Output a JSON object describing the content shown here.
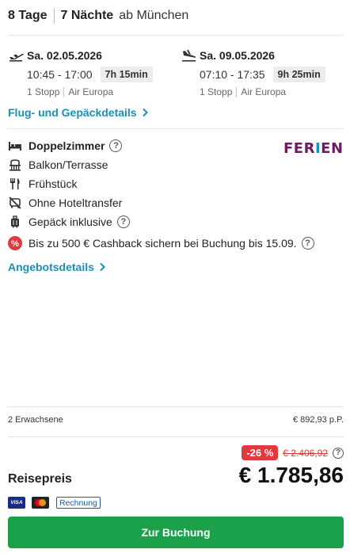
{
  "header": {
    "days": "8 Tage",
    "nights": "7 Nächte",
    "departure": "ab München"
  },
  "outbound": {
    "date": "Sa. 02.05.2026",
    "times": "10:45 - 17:00",
    "duration": "7h 15min",
    "stops": "1 Stopp",
    "airline": "Air Europa",
    "icon": "plane-takeoff-icon"
  },
  "inbound": {
    "date": "Sa. 09.05.2026",
    "times": "07:10 - 17:35",
    "duration": "9h 25min",
    "stops": "1 Stopp",
    "airline": "Air Europa",
    "icon": "plane-landing-icon"
  },
  "flight_details_link": "Flug- und Gepäckdetails",
  "features": {
    "room": "Doppelzimmer",
    "view": "Balkon/Terrasse",
    "board": "Frühstück",
    "transfer": "Ohne Hoteltransfer",
    "luggage": "Gepäck inklusive",
    "cashback": "Bis zu 500 € Cashback sichern bei Buchung bis 15.09."
  },
  "operator_logo": {
    "part1": "FER",
    "part2": "I",
    "part3": "EN",
    "color_primary": "#6e1c5f",
    "color_accent": "#1a8fb9"
  },
  "offer_details_link": "Angebotsdetails",
  "pricing": {
    "travellers": "2 Erwachsene",
    "per_person": "€ 892,93 p.P.",
    "discount": "-26 %",
    "old_price": "€ 2.406,92",
    "label": "Reisepreis",
    "total": "€ 1.785,86"
  },
  "payment": {
    "visa": "VISA",
    "invoice": "Rechnung"
  },
  "cta": {
    "label": "Zur Buchung",
    "color": "#1aa14a"
  }
}
